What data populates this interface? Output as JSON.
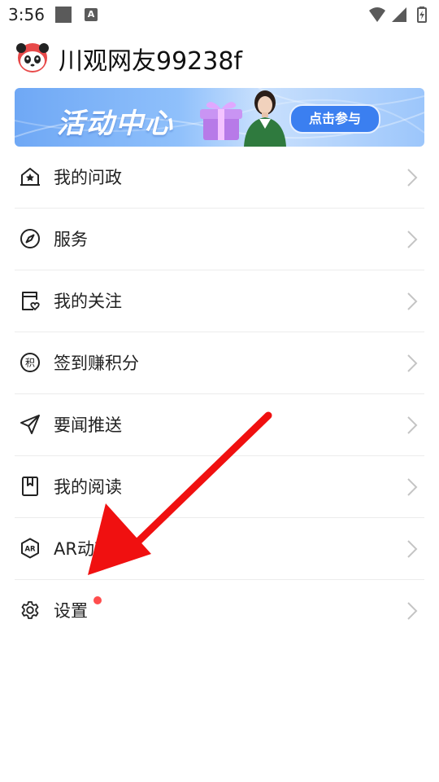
{
  "status_bar": {
    "time": "3:56",
    "badge_letter": "A"
  },
  "profile": {
    "username": "川观网友99238f"
  },
  "banner": {
    "title": "活动中心",
    "button_label": "点击参与"
  },
  "menu": {
    "items": [
      {
        "label": "我的问政",
        "icon": "star-house-icon"
      },
      {
        "label": "服务",
        "icon": "compass-icon"
      },
      {
        "label": "我的关注",
        "icon": "follow-heart-icon"
      },
      {
        "label": "签到赚积分",
        "icon": "points-icon"
      },
      {
        "label": "要闻推送",
        "icon": "send-icon"
      },
      {
        "label": "我的阅读",
        "icon": "bookmark-book-icon"
      },
      {
        "label": "AR动新闻",
        "icon": "ar-icon"
      },
      {
        "label": "设置",
        "icon": "gear-icon",
        "badge": true
      }
    ]
  },
  "colors": {
    "accent": "#ff4d4d",
    "banner_blue": "#3b7ff0",
    "annotation_arrow": "#f01010"
  }
}
